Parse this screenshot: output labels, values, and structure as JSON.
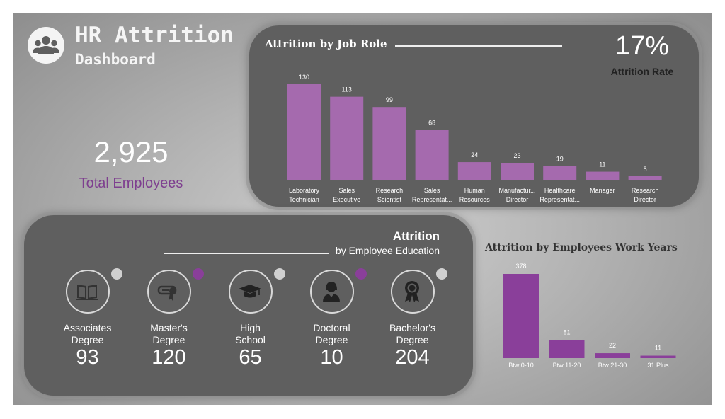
{
  "header": {
    "title_line1": "HR Attrition",
    "title_line2": "Dashboard",
    "logo_icon": "people-group-icon"
  },
  "kpi": {
    "total_employees_value": "2,925",
    "total_employees_label": "Total Employees",
    "attrition_rate_value": "17%",
    "attrition_rate_label": "Attrition Rate"
  },
  "colors": {
    "bar_light": "#a56aae",
    "bar_dark": "#8a3f9a",
    "accent_purple": "#7e3f8f",
    "panel": "#5f5f5f"
  },
  "education": {
    "title": "Attrition",
    "subtitle": "by Employee Education",
    "items": [
      {
        "label_line1": "Associates",
        "label_line2": "Degree",
        "value": "93",
        "icon": "book-icon",
        "dot_color": "#d0d0d0"
      },
      {
        "label_line1": "Master's",
        "label_line2": "Degree",
        "value": "120",
        "icon": "diploma-icon",
        "dot_color": "#8a3f9a"
      },
      {
        "label_line1": "High",
        "label_line2": "School",
        "value": "65",
        "icon": "graduation-cap-icon",
        "dot_color": "#d0d0d0"
      },
      {
        "label_line1": "Doctoral",
        "label_line2": "Degree",
        "value": "10",
        "icon": "doctor-icon",
        "dot_color": "#8a3f9a"
      },
      {
        "label_line1": "Bachelor's",
        "label_line2": "Degree",
        "value": "204",
        "icon": "award-ribbon-icon",
        "dot_color": "#d0d0d0"
      }
    ]
  },
  "chart_data": [
    {
      "type": "bar",
      "title": "Attrition by Job Role",
      "categories": [
        [
          "Laboratory",
          "Technician"
        ],
        [
          "Sales",
          "Executive"
        ],
        [
          "Research",
          "Scientist"
        ],
        [
          "Sales",
          "Representat..."
        ],
        [
          "Human",
          "Resources"
        ],
        [
          "Manufactur...",
          "Director"
        ],
        [
          "Healthcare",
          "Representat..."
        ],
        [
          "Manager"
        ],
        [
          "Research",
          "Director"
        ]
      ],
      "values": [
        130,
        113,
        99,
        68,
        24,
        23,
        19,
        11,
        5
      ],
      "ylim": [
        0,
        130
      ],
      "data_labels": true,
      "grid": false
    },
    {
      "type": "bar",
      "title": "Attrition by Employees Work Years",
      "categories": [
        "Btw 0-10",
        "Btw 11-20",
        "Btw 21-30",
        "31 Plus"
      ],
      "values": [
        378,
        81,
        22,
        11
      ],
      "ylim": [
        0,
        378
      ],
      "data_labels": true,
      "grid": false
    }
  ]
}
